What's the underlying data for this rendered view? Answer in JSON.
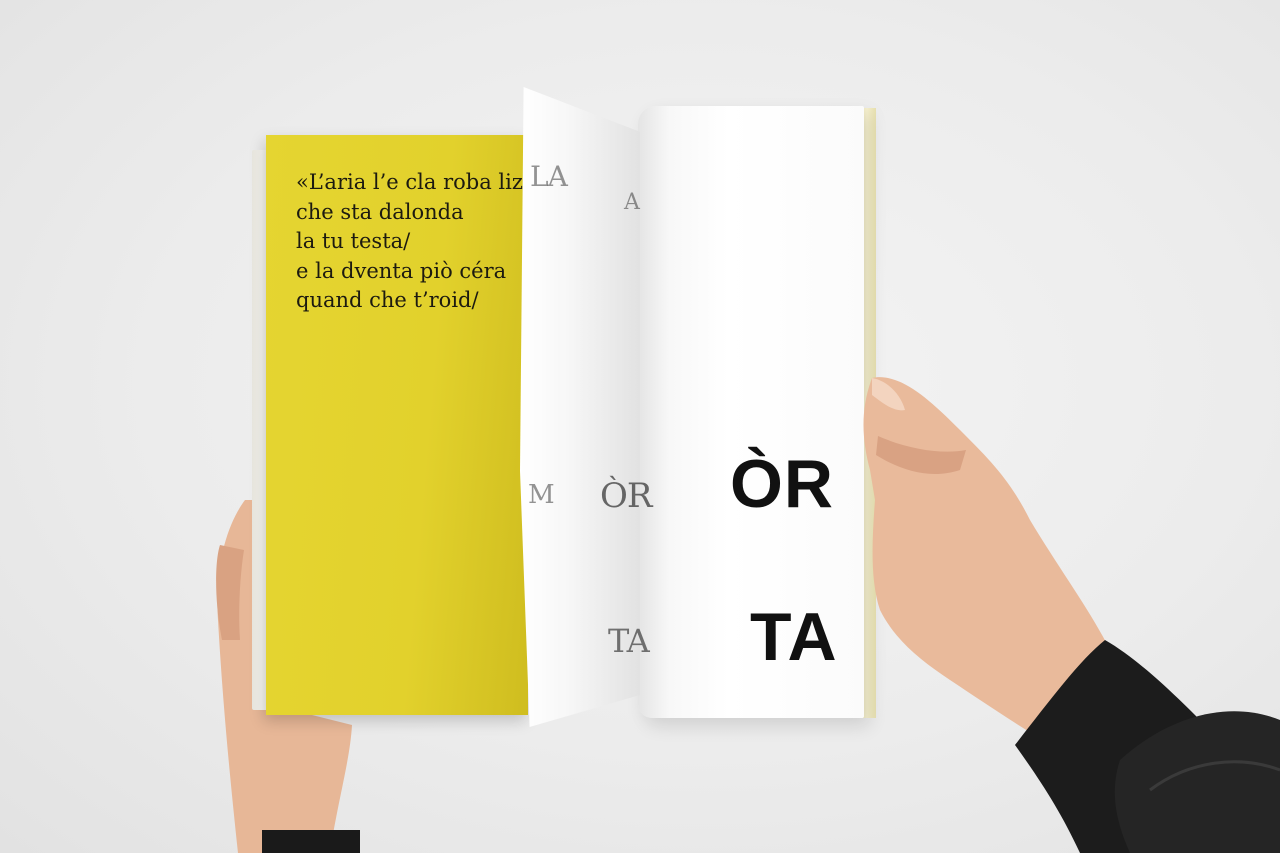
{
  "left_page": {
    "poem_lines": [
      "«L’aria l’e cla roba lizi",
      "che sta dalonda",
      "la tu testa/",
      "e la dventa piò céra",
      "quand che t’roid/"
    ]
  },
  "turning_page": {
    "ghost_top": "LA",
    "ghost_a": "A",
    "ghost_m": "M",
    "ghost_or": "ÒR",
    "ghost_ta": "TA"
  },
  "right_page": {
    "word_top": "ÒR",
    "word_bottom": "TA"
  },
  "colors": {
    "page_yellow": "#e3d22e",
    "background": "#ececec",
    "skin": "#e8b99a",
    "sleeve": "#1b1b1b"
  }
}
